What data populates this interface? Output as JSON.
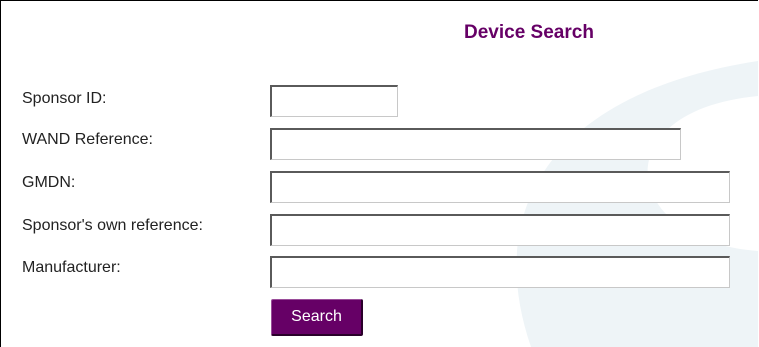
{
  "form": {
    "title": "Device Search",
    "fields": [
      {
        "label": "Sponsor ID:",
        "value": "",
        "placeholder": ""
      },
      {
        "label": "WAND Reference:",
        "value": "",
        "placeholder": ""
      },
      {
        "label": "GMDN:",
        "value": "",
        "placeholder": ""
      },
      {
        "label": "Sponsor's own reference:",
        "value": "",
        "placeholder": ""
      },
      {
        "label": "Manufacturer:",
        "value": "",
        "placeholder": ""
      }
    ],
    "search_label": "Search"
  },
  "colors": {
    "accent": "#660066",
    "watermark": "#eef4f7"
  }
}
